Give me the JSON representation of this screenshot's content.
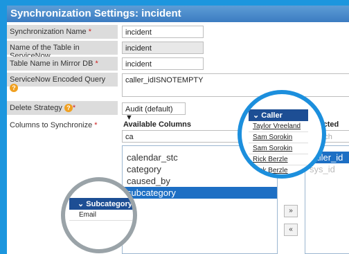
{
  "title": "Synchronization Settings: incident",
  "fields": {
    "sync_name": {
      "label": "Synchronization Name",
      "value": "incident"
    },
    "table_name": {
      "label": "Name of the Table in ServiceNow",
      "value": "incident"
    },
    "mirror_table": {
      "label": "Table Name in Mirror DB",
      "value": "incident"
    },
    "encoded_query": {
      "label": "ServiceNow Encoded Query",
      "value": "caller_idISNOTEMPTY"
    },
    "delete_strategy": {
      "label": "Delete Strategy",
      "value": "Audit (default)"
    },
    "columns": {
      "label": "Columns to Synchronize"
    }
  },
  "required_mark": "*",
  "help_glyph": "?",
  "available": {
    "header": "Available Columns",
    "filter": "ca",
    "items": [
      "calendar_stc",
      "category",
      "caused_by",
      "subcategory"
    ],
    "selected_index": 3
  },
  "selected": {
    "header": "Selected Colum",
    "search_placeholder": "Search",
    "items": [
      "caller_id",
      "sys_id"
    ],
    "selected_index": 0
  },
  "buttons": {
    "add": "»",
    "remove": "«"
  },
  "caller_popup": {
    "header": "Caller",
    "items": [
      "Taylor Vreeland",
      "Sam Sorokin",
      "Sam Sorokin",
      "Rick Berzle",
      "Rick Berzle"
    ]
  },
  "subcategory_popup": {
    "header": "Subcategory",
    "items": [
      "Email"
    ]
  },
  "colors": {
    "background": "#1c96de",
    "title_bar": "#3c7cc1",
    "selection": "#1d6fc4",
    "popup_header": "#1d4e94"
  }
}
